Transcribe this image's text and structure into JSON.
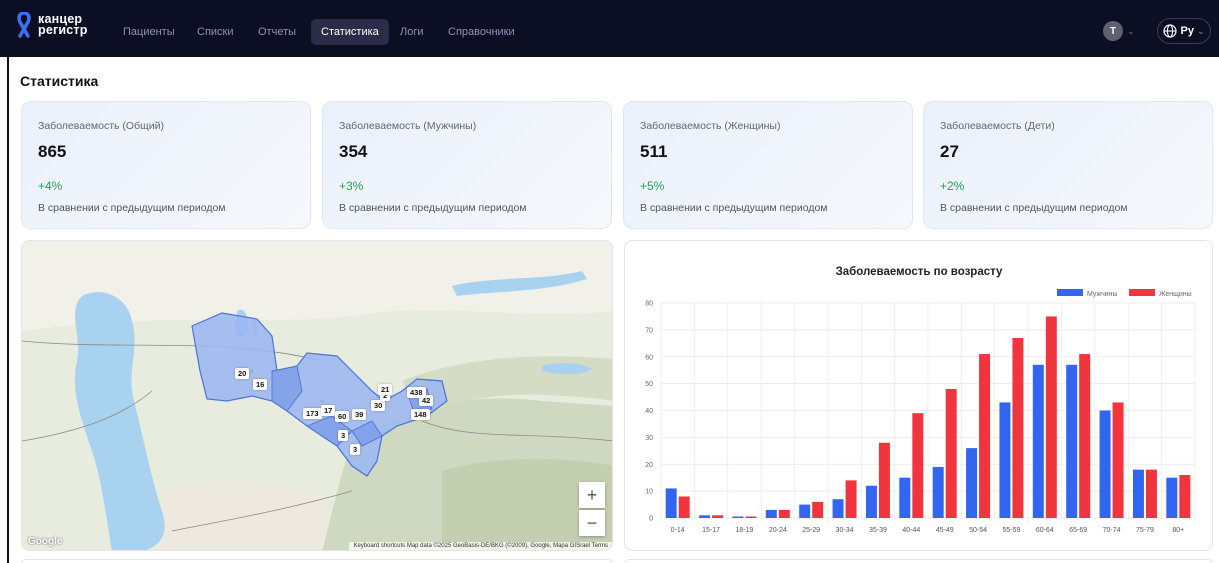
{
  "nav": {
    "logo": [
      "канцер",
      "регистр"
    ],
    "items": [
      {
        "label": "Пациенты",
        "active": false
      },
      {
        "label": "Списки",
        "active": false
      },
      {
        "label": "Отчеты",
        "active": false
      },
      {
        "label": "Статистика",
        "active": true
      },
      {
        "label": "Логи",
        "active": false
      },
      {
        "label": "Справочники",
        "active": false
      }
    ],
    "user_initial": "T",
    "language": "Ру"
  },
  "page_title": "Статистика",
  "cards": [
    {
      "label": "Заболеваемость (Общий)",
      "value": "865",
      "change": "+4%",
      "note": "В сравнении с предыдущим периодом"
    },
    {
      "label": "Заболеваемость (Мужчины)",
      "value": "354",
      "change": "+3%",
      "note": "В сравнении с предыдущим периодом"
    },
    {
      "label": "Заболеваемость (Женщины)",
      "value": "511",
      "change": "+5%",
      "note": "В сравнении с предыдущим периодом"
    },
    {
      "label": "Заболеваемость (Дети)",
      "value": "27",
      "change": "+2%",
      "note": "В сравнении с предыдущим периодом"
    }
  ],
  "map": {
    "markers": [
      "20",
      "16",
      "173",
      "17",
      "60",
      "39",
      "30",
      "2",
      "21",
      "3",
      "3",
      "42",
      "148",
      "438"
    ],
    "attribution": "Keyboard shortcuts   Map data ©2025 GeoBasis-DE/BKG (©2009), Google, Mapa GISrael   Terms",
    "google": "Google",
    "zoom_in": "+",
    "zoom_out": "−"
  },
  "chart_data": {
    "type": "bar",
    "title": "Заболеваемость по возрасту",
    "categories": [
      "0-14",
      "15-17",
      "18-19",
      "20-24",
      "25-29",
      "30-34",
      "35-39",
      "40-44",
      "45-49",
      "50-54",
      "55-59",
      "60-64",
      "65-69",
      "70-74",
      "75-79",
      "80+"
    ],
    "series": [
      {
        "name": "Мужчины",
        "color": "#3366f0",
        "values": [
          11,
          1,
          0,
          3,
          5,
          7,
          12,
          15,
          19,
          26,
          43,
          57,
          57,
          40,
          18,
          15
        ]
      },
      {
        "name": "Женщины",
        "color": "#f0353f",
        "values": [
          8,
          1,
          0,
          3,
          6,
          14,
          28,
          39,
          48,
          61,
          67,
          75,
          61,
          43,
          18,
          16
        ]
      }
    ],
    "ylim": [
      0,
      80
    ],
    "yticks": [
      0,
      10,
      20,
      30,
      40,
      50,
      60,
      70,
      80
    ],
    "legend": "top-right",
    "grid": true
  }
}
